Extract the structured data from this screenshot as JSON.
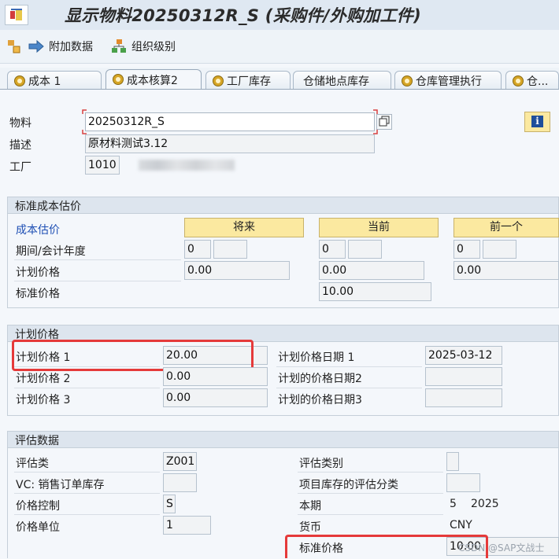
{
  "window": {
    "title": "显示物料20250312R_S (采购件/外购加工件)"
  },
  "toolbar": {
    "additional_data": "附加数据",
    "org_levels": "组织级别"
  },
  "tabs": [
    "成本 1",
    "成本核算2",
    "工厂库存",
    "仓储地点库存",
    "仓库管理执行",
    "仓..."
  ],
  "header": {
    "material_label": "物料",
    "material_value": "20250312R_S",
    "desc_label": "描述",
    "desc_value": "原材料测试3.12",
    "plant_label": "工厂",
    "plant_value": "1010"
  },
  "std_cost_estimate": {
    "title": "标准成本估价",
    "cost_estimate_label": "成本估价",
    "col_future": "将来",
    "col_current": "当前",
    "col_previous": "前一个",
    "period_label": "期间/会计年度",
    "planned_price_label": "计划价格",
    "standard_price_label": "标准价格",
    "future_period": "0",
    "current_period": "0",
    "previous_period": "0",
    "future_planned": "0.00",
    "current_planned": "0.00",
    "previous_planned": "0.00",
    "current_standard": "10.00"
  },
  "planned_prices": {
    "title": "计划价格",
    "pp1_label": "计划价格 1",
    "pp1_value": "20.00",
    "pp2_label": "计划价格 2",
    "pp2_value": "0.00",
    "pp3_label": "计划价格 3",
    "pp3_value": "0.00",
    "ppd1_label": "计划价格日期 1",
    "ppd1_value": "2025-03-12",
    "ppd2_label": "计划的价格日期2",
    "ppd3_label": "计划的价格日期3"
  },
  "valuation": {
    "title": "评估数据",
    "val_class_label": "评估类",
    "val_class_value": "Z001",
    "vc_label": "VC: 销售订单库存",
    "price_ctrl_label": "价格控制",
    "price_ctrl_value": "S",
    "price_unit_label": "价格单位",
    "price_unit_value": "1",
    "val_category_label": "评估类别",
    "proj_stock_label": "项目库存的评估分类",
    "period_label": "本期",
    "period_value": "5",
    "year_value": "2025",
    "currency_label": "货币",
    "currency_value": "CNY",
    "standard_price_label": "标准价格",
    "standard_price_value": "10.00"
  },
  "watermark": "CSDN @SAP文战士"
}
